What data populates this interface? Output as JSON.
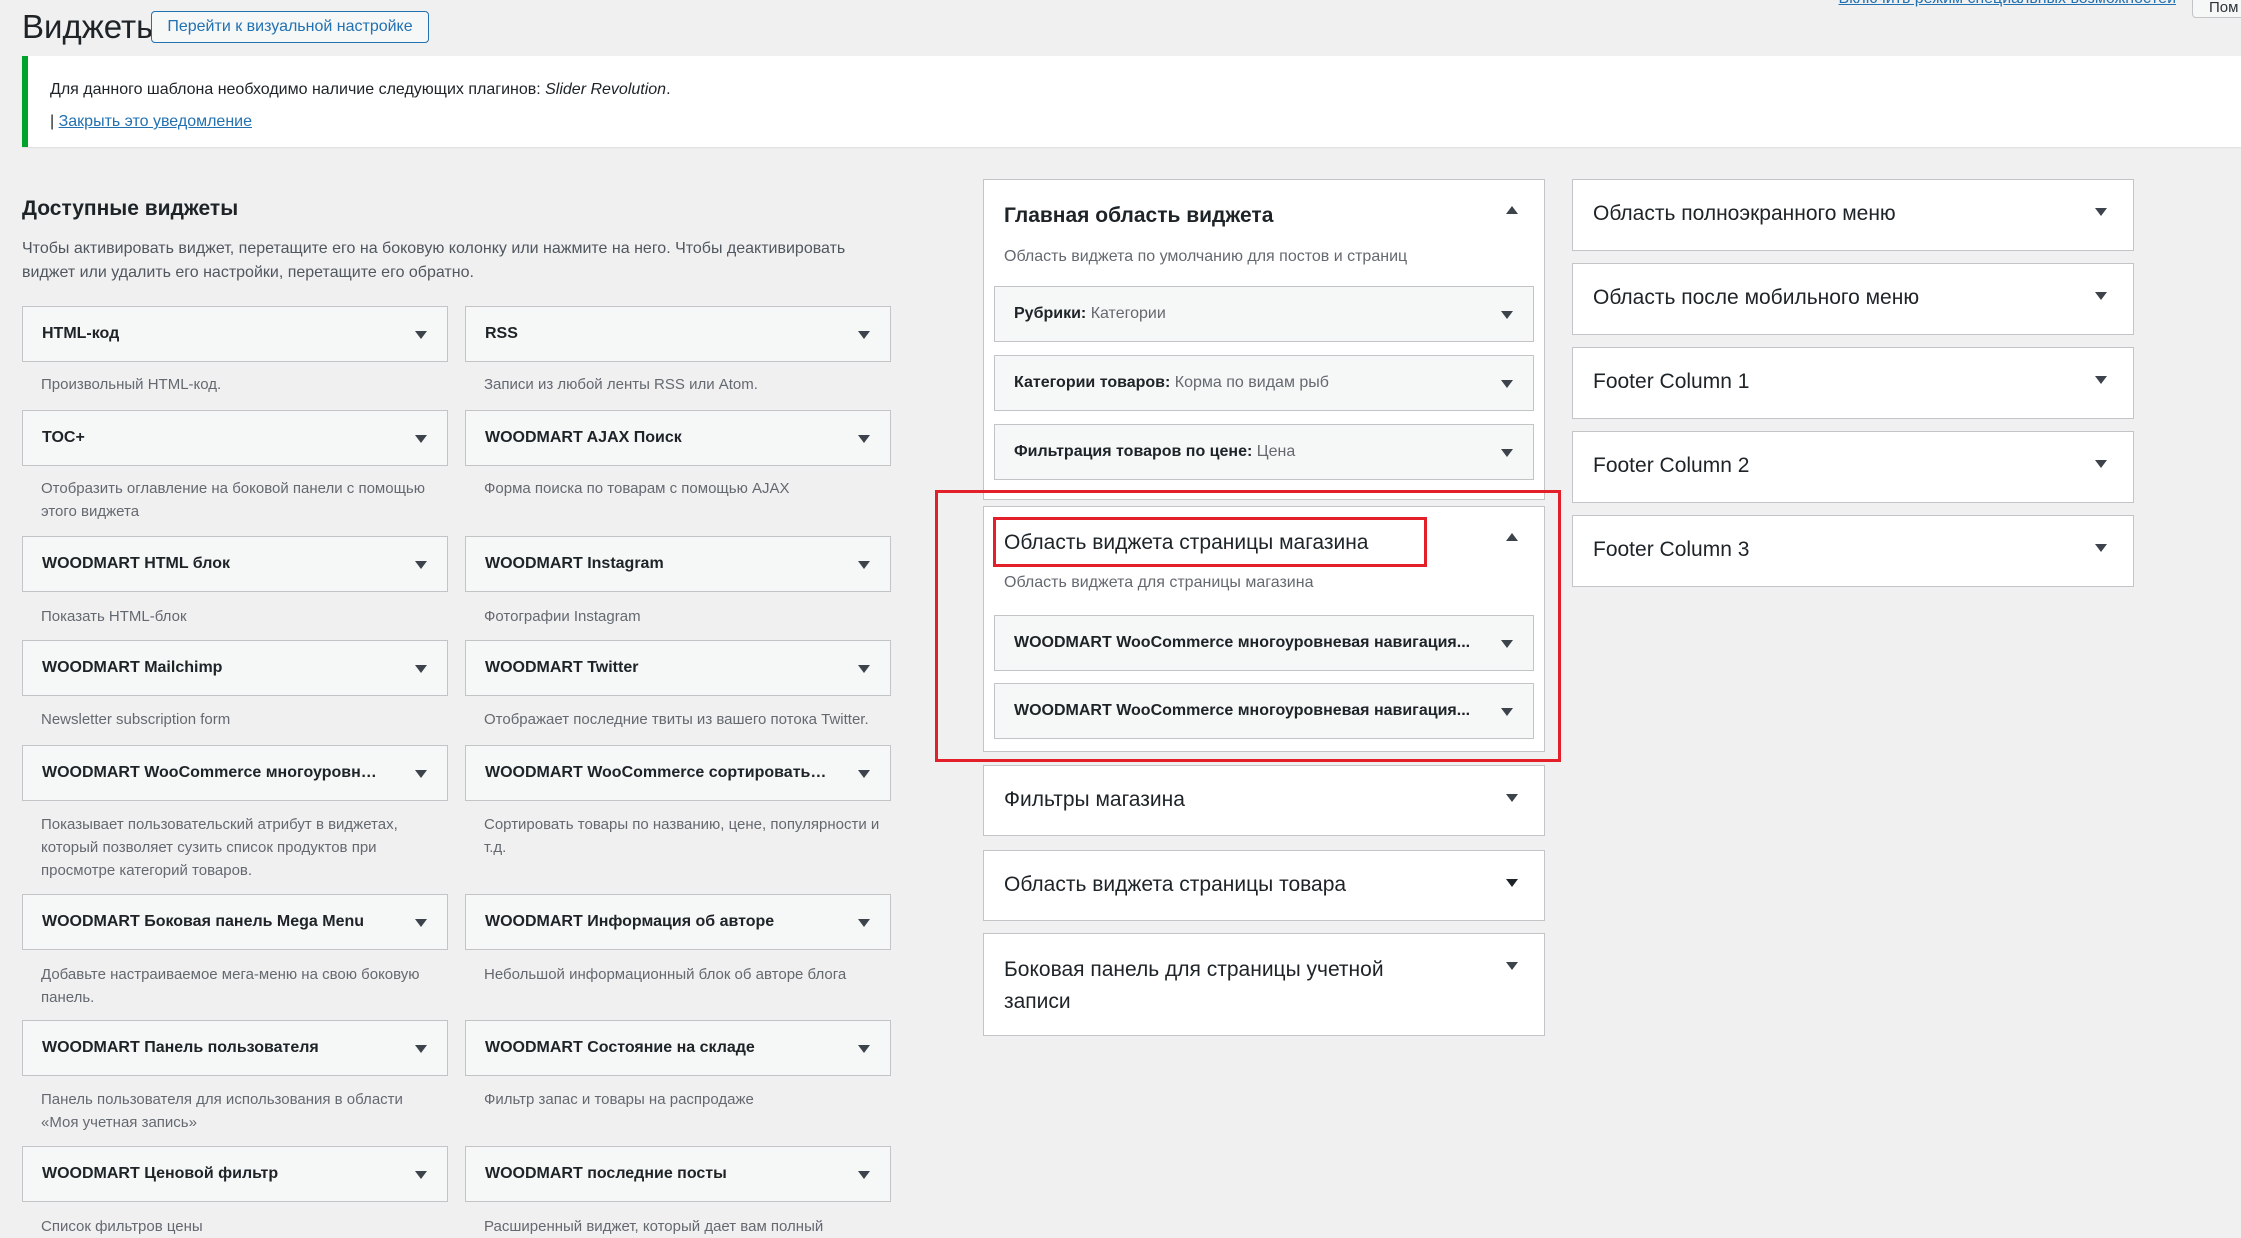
{
  "header": {
    "title": "Виджеты",
    "visual_button": "Перейти к визуальной настройке",
    "accessibility_link": "Включить режим специальных возможностей",
    "screen_options": "Пом"
  },
  "notice": {
    "text": "Для данного шаблона необходимо наличие следующих плагинов: ",
    "plugin": "Slider Revolution",
    "period": ".",
    "separator": "| ",
    "close_link": "Закрыть это уведомление"
  },
  "available": {
    "heading": "Доступные виджеты",
    "description": "Чтобы активировать виджет, перетащите его на боковую колонку или нажмите на него. Чтобы деактивировать виджет или удалить его настройки, перетащите его обратно.",
    "widgets": [
      {
        "title": "HTML-код",
        "desc": "Произвольный HTML-код."
      },
      {
        "title": "RSS",
        "desc": "Записи из любой ленты RSS или Atom."
      },
      {
        "title": "TOC+",
        "desc": "Отобразить оглавление на боковой панели с помощью этого виджета"
      },
      {
        "title": "WOODMART AJAX Поиск",
        "desc": "Форма поиска по товарам с помощью AJAX"
      },
      {
        "title": "WOODMART HTML блок",
        "desc": "Показать HTML-блок"
      },
      {
        "title": "WOODMART Instagram",
        "desc": "Фотографии Instagram"
      },
      {
        "title": "WOODMART Mailchimp",
        "desc": "Newsletter subscription form"
      },
      {
        "title": "WOODMART Twitter",
        "desc": "Отображает последние твиты из вашего потока Twitter."
      },
      {
        "title": "WOODMART WooCommerce многоуровн…",
        "desc": "Показывает пользовательский атрибут в виджетах, который позволяет сузить список продуктов при просмотре категорий товаров."
      },
      {
        "title": "WOODMART WooCommerce сортировать…",
        "desc": "Сортировать товары по названию, цене, популярности и т.д."
      },
      {
        "title": "WOODMART Боковая панель Mega Menu",
        "desc": "Добавьте настраиваемое мега-меню на свою боковую панель."
      },
      {
        "title": "WOODMART Информация об авторе",
        "desc": "Небольшой информационный блок об авторе блога"
      },
      {
        "title": "WOODMART Панель пользователя",
        "desc": "Панель пользователя для использования в области «Моя учетная запись»"
      },
      {
        "title": "WOODMART Состояние на складе",
        "desc": "Фильтр запас и товары на распродаже"
      },
      {
        "title": "WOODMART Ценовой фильтр",
        "desc": "Список фильтров цены"
      },
      {
        "title": "WOODMART последние посты",
        "desc": "Расширенный виджет, который дает вам полный"
      }
    ]
  },
  "areas_middle": {
    "main": {
      "title": "Главная область виджета",
      "desc": "Область виджета по умолчанию для постов и страниц",
      "items": [
        {
          "name": "Рубрики",
          "sub": "Категории"
        },
        {
          "name": "Категории товаров",
          "sub": "Корма по видам рыб"
        },
        {
          "name": "Фильтрация товаров по цене",
          "sub": "Цена"
        }
      ]
    },
    "shop": {
      "title": "Область виджета страницы магазина",
      "desc": "Область виджета для страницы магазина",
      "items": [
        {
          "name": "WOODMART WooCommerce многоуровневая навигация..."
        },
        {
          "name": "WOODMART WooCommerce многоуровневая навигация..."
        }
      ]
    },
    "filters": "Фильтры магазина",
    "product": "Область виджета страницы товара",
    "account": "Боковая панель для страницы учетной записи"
  },
  "areas_right": [
    "Область полноэкранного меню",
    "Область после мобильного меню",
    "Footer Column 1",
    "Footer Column 2",
    "Footer Column 3"
  ],
  "colors": {
    "accent": "#2271b1",
    "notice_border": "#00a32a",
    "highlight": "#e3202a",
    "background": "#f0f0f1"
  }
}
